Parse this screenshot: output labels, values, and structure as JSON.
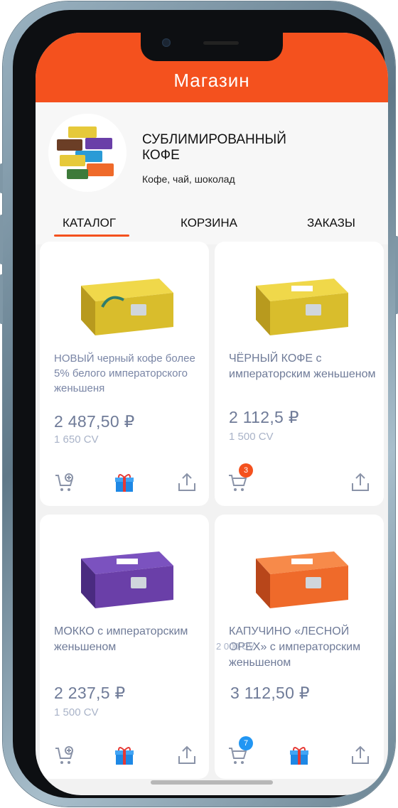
{
  "header": {
    "title": "Магазин",
    "color": "#f4511e"
  },
  "shop": {
    "name": "СУБЛИМИРОВАННЫЙ КОФЕ",
    "subtitle": "Кофе, чай, шоколад"
  },
  "tabs": [
    {
      "label": "КАТАЛОГ",
      "active": true
    },
    {
      "label": "КОРЗИНА",
      "active": false
    },
    {
      "label": "ЗАКАЗЫ",
      "active": false
    }
  ],
  "products": [
    {
      "title": "НОВЫЙ черный кофе более 5% белого императорского женьшеня",
      "price": "2 487,50 ₽",
      "cv": "1 650 CV",
      "box_color": "#e6c93a",
      "cart_badge": null,
      "has_gift": true
    },
    {
      "title": "ЧЁРНЫЙ КОФЕ с императорским женьшеном",
      "price": "2 112,5 ₽",
      "cv": "1 500 CV",
      "box_color": "#e6c93a",
      "cart_badge": "3",
      "badge_color": "#f4511e",
      "has_gift": false
    },
    {
      "title": "МОККО с императорским женьшеном",
      "price": "2 237,5 ₽",
      "cv": "1 500 CV",
      "box_color": "#6a3fa8",
      "cart_badge": null,
      "has_gift": true
    },
    {
      "title": "КАПУЧИНО «ЛЕСНОЙ ОРЕХ» с императорским женьшеном",
      "price": "3 112,50 ₽",
      "cv": "",
      "ghost_cv": "2 000 CV",
      "box_color": "#ef6a2a",
      "cart_badge": "7",
      "badge_color": "#2196f3",
      "has_gift": true
    }
  ],
  "icons": {
    "cart": "cart-icon",
    "cart_add": "cart-add-icon",
    "gift": "gift-icon",
    "share": "share-icon"
  }
}
